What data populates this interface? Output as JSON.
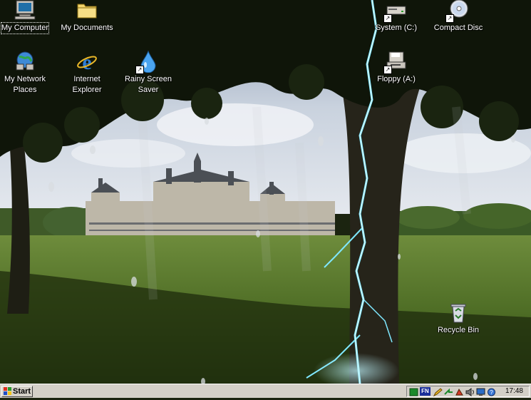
{
  "desktop": {
    "icons": [
      {
        "label": "My Computer",
        "icon": "my-computer-icon"
      },
      {
        "label": "My Documents",
        "icon": "folder-icon"
      },
      {
        "label": "System (C:)",
        "icon": "drive-icon"
      },
      {
        "label": "Compact Disc",
        "icon": "cd-icon"
      },
      {
        "label": "My Network\nPlaces",
        "icon": "network-icon"
      },
      {
        "label": "Internet\nExplorer",
        "icon": "internet-explorer-icon"
      },
      {
        "label": "Rainy Screen\nSaver",
        "icon": "water-drop-icon"
      },
      {
        "label": "Floppy (A:)",
        "icon": "floppy-icon"
      },
      {
        "label": "Recycle Bin",
        "icon": "recycle-bin-icon"
      }
    ],
    "selected": "My Computer",
    "wallpaper": "chateau-with-tree-and-lightning"
  },
  "taskbar": {
    "start_label": "Start",
    "tray": {
      "language": "FN",
      "clock": "17:48",
      "icons": [
        "network-status-icon",
        "language-indicator",
        "pencil-tray-icon",
        "arrow-tray-icon",
        "paint-tray-icon",
        "volume-icon",
        "monitor-tray-icon",
        "help-tray-icon"
      ]
    }
  },
  "colors": {
    "taskbar": "#d4d0c8",
    "start_flag_red": "#e0301e",
    "start_flag_green": "#2a9a2a",
    "start_flag_blue": "#1f4fc8",
    "start_flag_yellow": "#f5c518",
    "lightning": "#7fe8ff"
  }
}
